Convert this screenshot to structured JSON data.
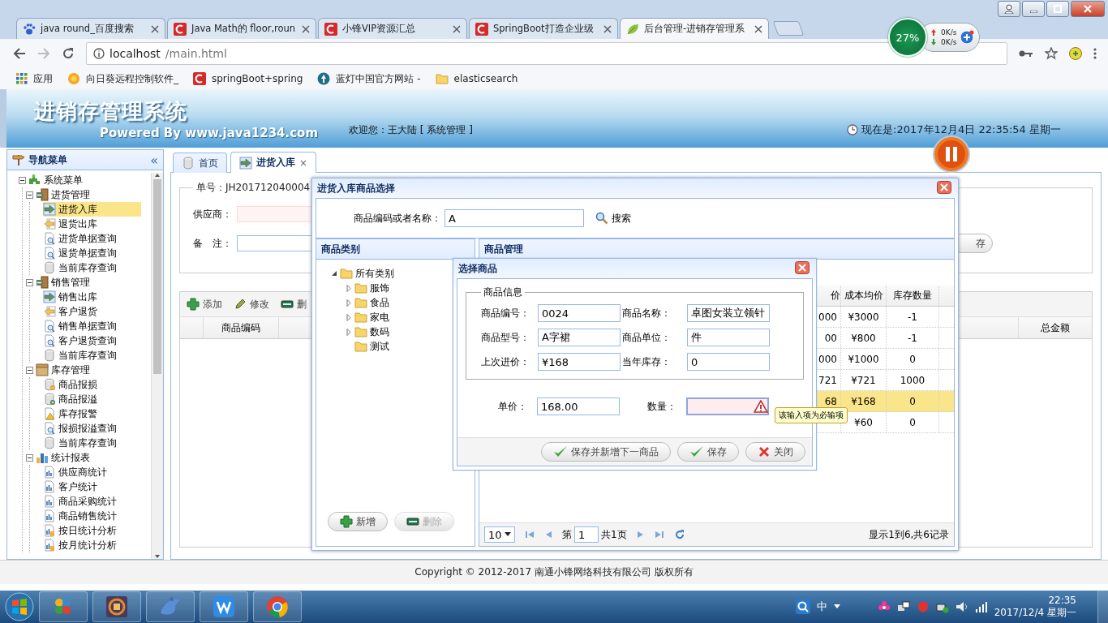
{
  "browser": {
    "tabs": [
      {
        "title": "java round_百度搜索",
        "kind": "paw",
        "selected": false
      },
      {
        "title": "Java Math的 floor,roun",
        "kind": "red",
        "selected": false
      },
      {
        "title": "小锋VIP资源汇总",
        "kind": "red",
        "selected": false
      },
      {
        "title": "SpringBoot打造企业级",
        "kind": "red",
        "selected": false
      },
      {
        "title": "后台管理-进销存管理系",
        "kind": "leaf",
        "selected": true
      }
    ],
    "address": {
      "host": "localhost",
      "path": "/main.html"
    },
    "bookmarks": [
      {
        "label": "应用",
        "kind": "apps"
      },
      {
        "label": "向日葵远程控制软件_",
        "kind": "sun"
      },
      {
        "label": "springBoot+spring",
        "kind": "red"
      },
      {
        "label": "蓝灯中国官方网站 -",
        "kind": "lantern"
      },
      {
        "label": "elasticsearch",
        "kind": "folder"
      }
    ]
  },
  "net_monitor": {
    "percent": "27%",
    "upload": "0K/s",
    "download": "0K/s"
  },
  "header": {
    "title": "进销存管理系统",
    "powered": "Powered By www.java1234.com",
    "welcome": "欢迎您：王大陆 [ 系统管理 ]",
    "clock": "现在是:2017年12月4日 22:35:54 星期一"
  },
  "sidebar": {
    "title": "导航菜单",
    "collapse": "«",
    "tree": [
      {
        "label": "系统菜单",
        "kind": "root",
        "expanded": true,
        "selected": false,
        "children": [
          {
            "label": "进货管理",
            "kind": "door",
            "expanded": true,
            "selected": false,
            "children": [
              {
                "label": "进货入库",
                "kind": "in",
                "selected": true
              },
              {
                "label": "退货出库",
                "kind": "out",
                "selected": false
              },
              {
                "label": "进货单据查询",
                "kind": "query",
                "selected": false
              },
              {
                "label": "退货单据查询",
                "kind": "query",
                "selected": false
              },
              {
                "label": "当前库存查询",
                "kind": "stock",
                "selected": false
              }
            ]
          },
          {
            "label": "销售管理",
            "kind": "door",
            "expanded": true,
            "selected": false,
            "children": [
              {
                "label": "销售出库",
                "kind": "in",
                "selected": false
              },
              {
                "label": "客户退货",
                "kind": "out",
                "selected": false
              },
              {
                "label": "销售单据查询",
                "kind": "query",
                "selected": false
              },
              {
                "label": "客户退货查询",
                "kind": "query",
                "selected": false
              },
              {
                "label": "当前库存查询",
                "kind": "stock",
                "selected": false
              }
            ]
          },
          {
            "label": "库存管理",
            "kind": "box",
            "expanded": true,
            "selected": false,
            "children": [
              {
                "label": "商品报损",
                "kind": "loss",
                "selected": false
              },
              {
                "label": "商品报溢",
                "kind": "overflow",
                "selected": false
              },
              {
                "label": "库存报警",
                "kind": "alarm",
                "selected": false
              },
              {
                "label": "报损报溢查询",
                "kind": "query",
                "selected": false
              },
              {
                "label": "当前库存查询",
                "kind": "stock",
                "selected": false
              }
            ]
          },
          {
            "label": "统计报表",
            "kind": "chart",
            "expanded": true,
            "selected": false,
            "children": [
              {
                "label": "供应商统计",
                "kind": "report",
                "selected": false
              },
              {
                "label": "客户统计",
                "kind": "report",
                "selected": false
              },
              {
                "label": "商品采购统计",
                "kind": "report",
                "selected": false
              },
              {
                "label": "商品销售统计",
                "kind": "report",
                "selected": false
              },
              {
                "label": "按日统计分析",
                "kind": "analysis",
                "selected": false
              },
              {
                "label": "按月统计分析",
                "kind": "analysis",
                "selected": false
              }
            ]
          }
        ]
      }
    ]
  },
  "main_tabs": [
    {
      "label": "首页",
      "kind": "home",
      "selected": false
    },
    {
      "label": "进货入库",
      "kind": "in",
      "selected": true,
      "close": "×"
    }
  ],
  "purchase_form": {
    "legend": "单号：JH201712040004",
    "supplier": {
      "label": "供应商：",
      "invalid": true
    },
    "note": {
      "label": "备　注："
    },
    "save_button": "存"
  },
  "purchase_toolbar": [
    {
      "label": "添加",
      "kind": "add"
    },
    {
      "label": "修改",
      "kind": "edit"
    },
    {
      "label": "删",
      "kind": "delete"
    }
  ],
  "purchase_grid": {
    "columns": [
      "商品编码",
      "总金额"
    ]
  },
  "pick_dialog": {
    "title": "进货入库商品选择",
    "search_label": "商品编码或者名称：",
    "search_value": "A",
    "search_button": "搜索",
    "category_panel": {
      "title": "商品类别",
      "tree": [
        {
          "label": "所有类别",
          "expanded": true,
          "selected": false,
          "children": [
            {
              "label": "服饰",
              "expanded": false,
              "selected": false
            },
            {
              "label": "食品",
              "expanded": false,
              "selected": false
            },
            {
              "label": "家电",
              "expanded": false,
              "selected": false
            },
            {
              "label": "数码",
              "expanded": false,
              "selected": false
            },
            {
              "label": "测试",
              "selected": false
            }
          ]
        }
      ],
      "buttons": [
        {
          "label": "新增",
          "kind": "add",
          "disabled": false
        },
        {
          "label": "删除",
          "kind": "delete",
          "disabled": true
        }
      ]
    },
    "goods_panel": {
      "title": "商品管理",
      "columns": [
        "价",
        "成本均价",
        "库存数量"
      ],
      "rows": [
        {
          "price": "000",
          "avg_cost": "¥3000",
          "stock": "-1",
          "selected": false
        },
        {
          "price": "00",
          "avg_cost": "¥800",
          "stock": "-1",
          "selected": false
        },
        {
          "price": "000",
          "avg_cost": "¥1000",
          "stock": "0",
          "selected": false
        },
        {
          "price": "721",
          "avg_cost": "¥721",
          "stock": "1000",
          "selected": false
        },
        {
          "price": "68",
          "avg_cost": "¥168",
          "stock": "0",
          "selected": true
        },
        {
          "avg_cost": "¥60",
          "stock": "0",
          "selected": false
        }
      ],
      "pager": {
        "page_size": "10",
        "page_label": "第",
        "page": "1",
        "total_pages": "共1页",
        "summary": "显示1到6,共6记录"
      }
    }
  },
  "select_dialog": {
    "title": "选择商品",
    "legend": "商品信息",
    "fields": [
      {
        "label": "商品编号：",
        "value": "0024"
      },
      {
        "label": "商品名称：",
        "value": "卓图女装立领针"
      },
      {
        "label": "商品型号：",
        "value": "A字裙"
      },
      {
        "label": "商品单位：",
        "value": "件"
      },
      {
        "label": "上次进价：",
        "value": "¥168"
      },
      {
        "label": "当年库存：",
        "value": "0"
      }
    ],
    "price": {
      "label": "单价：",
      "value": "168.00"
    },
    "quantity": {
      "label": "数量：",
      "invalid": true
    },
    "tooltip": "该输入项为必输项",
    "buttons": [
      {
        "label": "保存并新增下一商品",
        "kind": "ok"
      },
      {
        "label": "保存",
        "kind": "ok"
      },
      {
        "label": "关闭",
        "kind": "cancel"
      }
    ]
  },
  "footer": "Copyright © 2012-2017 南通小锋网络科技有限公司 版权所有",
  "taskbar": {
    "apps": [
      {
        "kind": "pinwheel"
      },
      {
        "kind": "ide"
      },
      {
        "kind": "dolphin"
      },
      {
        "kind": "writer"
      },
      {
        "kind": "browser"
      }
    ],
    "ime": "中",
    "time": "22:35",
    "date": "2017/12/4 星期一"
  }
}
